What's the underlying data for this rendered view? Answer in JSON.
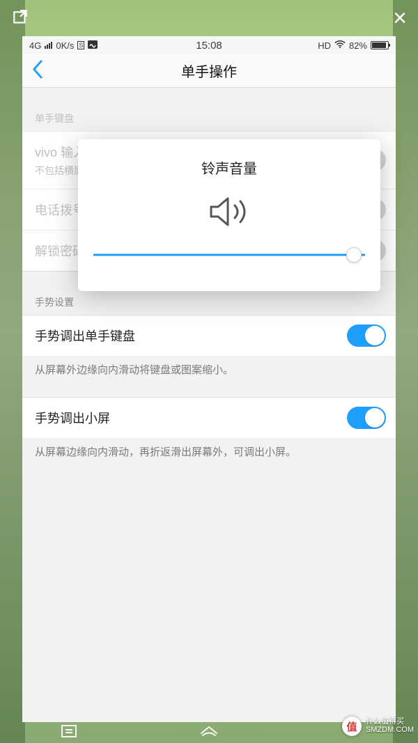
{
  "viewer": {
    "close_glyph": "×"
  },
  "status": {
    "network": "4G",
    "speed": "0K/s",
    "indicator": "S",
    "time": "15:08",
    "hd": "HD",
    "battery_pct": "82%",
    "battery_fill_pct": 82
  },
  "nav": {
    "title": "单手操作"
  },
  "sections": {
    "kb": {
      "header": "单手键盘",
      "items": [
        {
          "label": "vivo 输入法键盘",
          "sub": "不包括横屏键盘",
          "on": false
        },
        {
          "label": "电话拨号键盘",
          "on": false
        },
        {
          "label": "解锁密码/图案",
          "on": false
        }
      ]
    },
    "gesture": {
      "header": "手势设置",
      "items": [
        {
          "label": "手势调出单手键盘",
          "on": true,
          "desc": "从屏幕外边缘向内滑动将键盘或图案缩小。"
        },
        {
          "label": "手势调出小屏",
          "on": true,
          "desc": "从屏幕边缘向内滑动，再折返滑出屏幕外，可调出小屏。"
        }
      ]
    }
  },
  "modal": {
    "title": "铃声音量",
    "value_pct": 96
  },
  "watermark": {
    "glyph": "值",
    "line1": "什么值得买",
    "line2": "SMZDM.COM"
  }
}
